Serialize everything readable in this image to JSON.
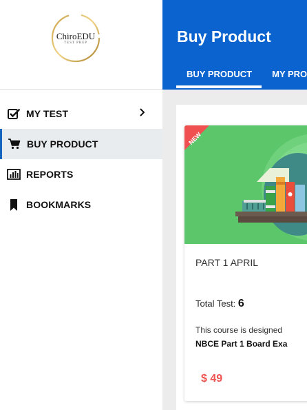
{
  "logo": {
    "brand": "ChiroEDU",
    "tagline": "TEST PREP"
  },
  "sidebar": {
    "items": [
      {
        "label": "MY TEST",
        "icon": "checkbox-icon",
        "has_chevron": true
      },
      {
        "label": "BUY PRODUCT",
        "icon": "cart-icon",
        "active": true
      },
      {
        "label": "REPORTS",
        "icon": "bar-chart-icon"
      },
      {
        "label": "BOOKMARKS",
        "icon": "bookmark-icon"
      }
    ]
  },
  "header": {
    "title": "Buy Product",
    "tabs": [
      {
        "label": "BUY PRODUCT",
        "active": true
      },
      {
        "label": "MY PRO"
      }
    ]
  },
  "products": [
    {
      "ribbon": "NEW",
      "title": "PART 1 APRIL",
      "tests_label": "Total Test:",
      "tests_count": "6",
      "desc_line1": "This course is designed",
      "desc_line2": "NBCE Part 1 Board Exa",
      "price": "$ 49"
    }
  ],
  "colors": {
    "header_bg": "#0a63cf",
    "price": "#ef5350",
    "card_image_bg": "#5cc66a",
    "ribbon": "#f0504f"
  }
}
